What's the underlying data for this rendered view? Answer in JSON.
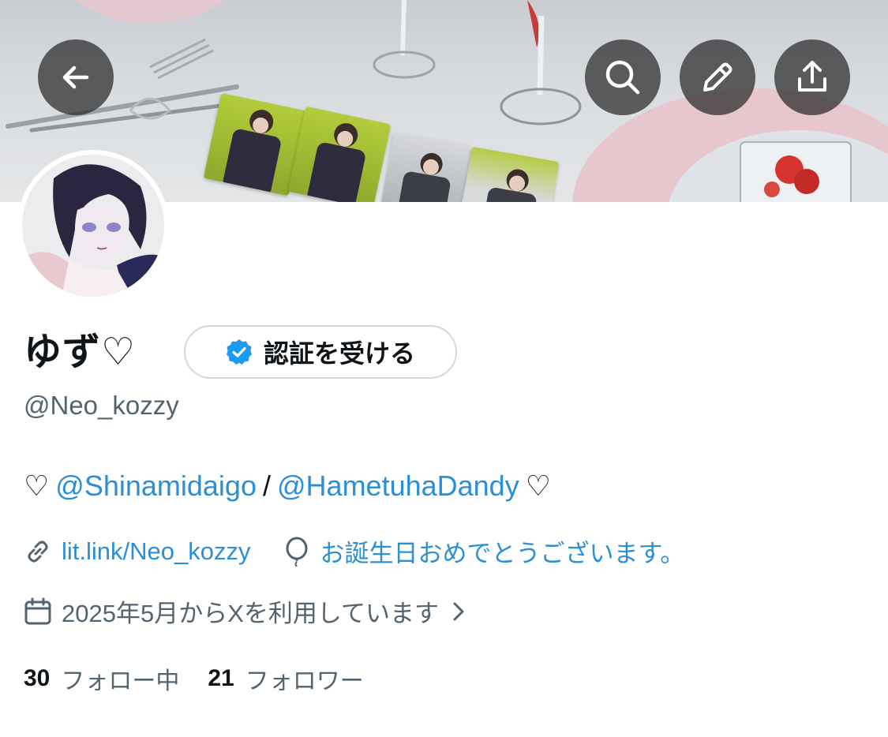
{
  "profile": {
    "display_name": "ゆず♡",
    "handle": "@Neo_kozzy",
    "verify_button_label": "認証を受ける",
    "bio": {
      "prefix_heart": "♡",
      "mention_1": "@Shinamidaigo",
      "separator": "/",
      "mention_2": "@HametuhaDandy",
      "suffix_heart": "♡"
    },
    "website": "lit.link/Neo_kozzy",
    "birthday_text": "お誕生日おめでとうございます。",
    "joined_text": "2025年5月からXを利用しています",
    "following_count": "30",
    "following_label": "フォロー中",
    "followers_count": "21",
    "followers_label": "フォロワー"
  },
  "icons": {
    "back": "arrow-left-icon",
    "search": "search-icon",
    "edit": "pencil-icon",
    "share": "share-icon",
    "verified": "verified-badge-icon",
    "link": "link-icon",
    "birthday": "balloon-icon",
    "calendar": "calendar-icon",
    "chevron": "chevron-right-icon"
  },
  "colors": {
    "link_blue": "#2b8fd6",
    "verified_blue": "#1d9bf0",
    "secondary_text": "#536471",
    "primary_text": "#0f1419"
  }
}
